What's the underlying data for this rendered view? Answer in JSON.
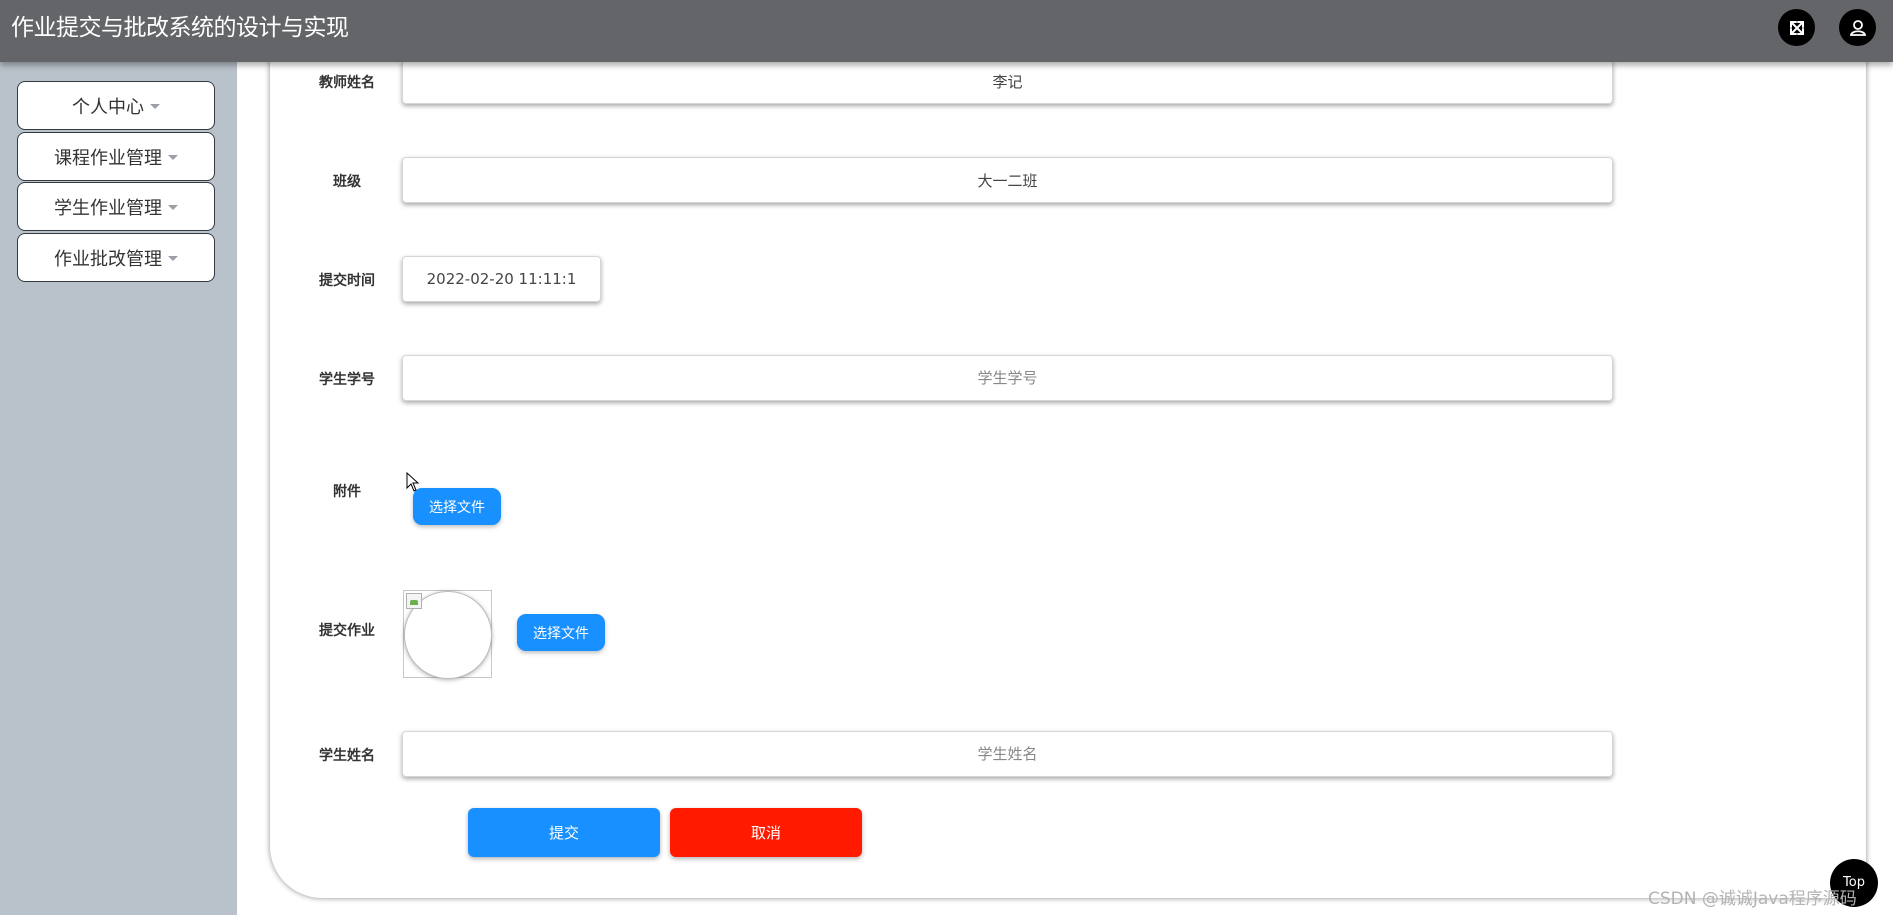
{
  "header": {
    "title": "作业提交与批改系统的设计与实现",
    "fullscreen_icon": "expand-arrows-icon",
    "user_icon": "user-icon"
  },
  "sidebar": {
    "items": [
      {
        "label": "个人中心"
      },
      {
        "label": "课程作业管理"
      },
      {
        "label": "学生作业管理"
      },
      {
        "label": "作业批改管理"
      }
    ]
  },
  "form": {
    "teacher_name": {
      "label": "教师姓名",
      "value": "李记"
    },
    "class": {
      "label": "班级",
      "value": "大一二班"
    },
    "submit_time": {
      "label": "提交时间",
      "value": "2022-02-20 11:11:1"
    },
    "student_id": {
      "label": "学生学号",
      "placeholder": "学生学号",
      "value": ""
    },
    "attachment": {
      "label": "附件",
      "button": "选择文件"
    },
    "homework": {
      "label": "提交作业",
      "button": "选择文件"
    },
    "student_name": {
      "label": "学生姓名",
      "placeholder": "学生姓名",
      "value": ""
    }
  },
  "actions": {
    "submit": "提交",
    "cancel": "取消"
  },
  "back_to_top": "Top",
  "watermark": "CSDN @诚诚Java程序源码",
  "colors": {
    "header_bg": "#636569",
    "sidebar_bg": "#b9c2ca",
    "primary": "#1890ff",
    "danger": "#ff1a00"
  }
}
